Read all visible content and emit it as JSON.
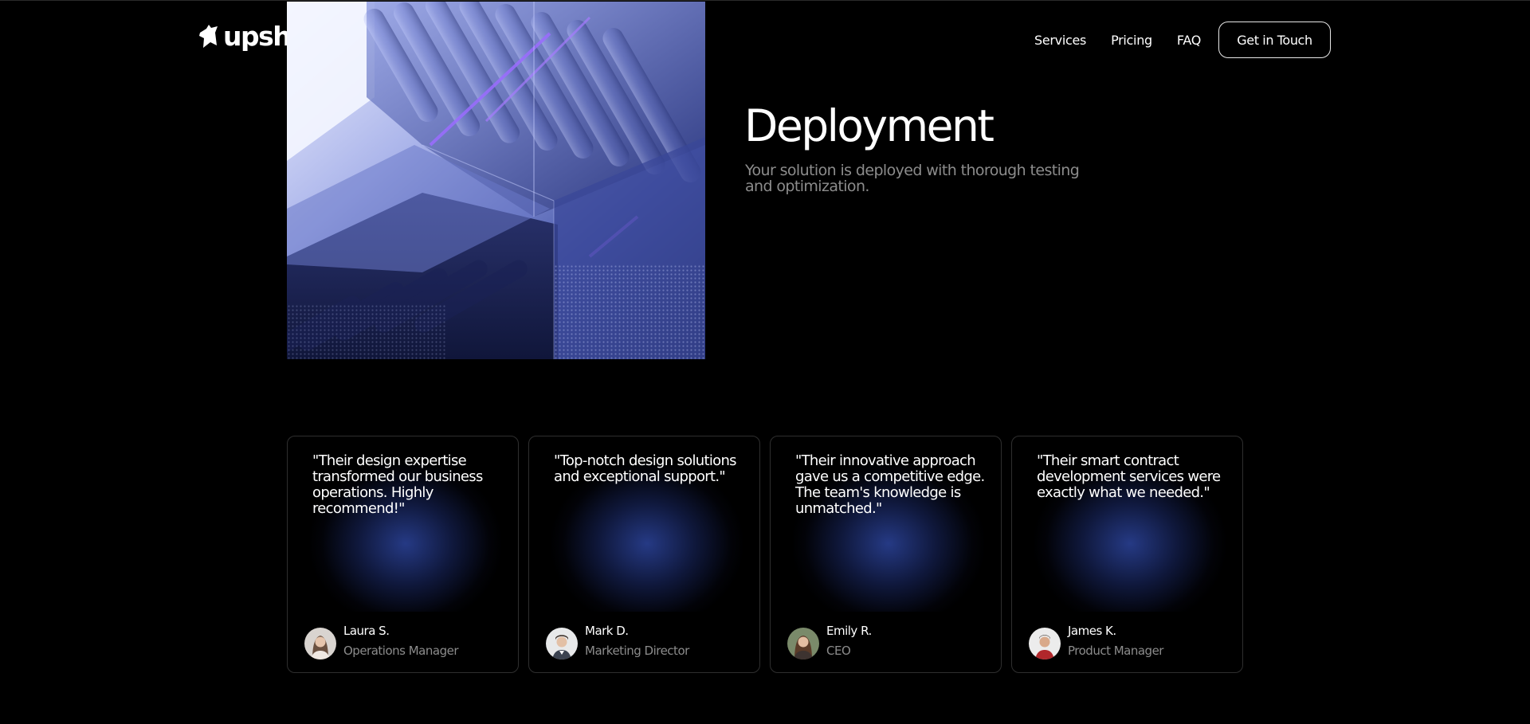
{
  "header": {
    "logo_text": "upshi",
    "logo_icon": "bird-logo-icon",
    "nav": [
      {
        "label": "Services"
      },
      {
        "label": "Pricing"
      },
      {
        "label": "FAQ"
      }
    ],
    "cta_label": "Get in Touch"
  },
  "step": {
    "title": "Deployment",
    "description": "Your solution is deployed with thorough testing and optimization."
  },
  "testimonials": [
    {
      "quote": "\"Their design expertise transformed our business operations. Highly recommend!\"",
      "name": "Laura S.",
      "role": "Operations Manager"
    },
    {
      "quote": "\"Top-notch design solutions and exceptional support.\"",
      "name": "Mark D.",
      "role": "Marketing Director"
    },
    {
      "quote": "\"Their innovative approach gave us a competitive edge. The team's knowledge is unmatched.\"",
      "name": "Emily R.",
      "role": "CEO"
    },
    {
      "quote": "\"Their smart contract development services were exactly what we needed.\"",
      "name": "James K.",
      "role": "Product Manager"
    }
  ],
  "colors": {
    "background": "#000000",
    "accent_glow": "#2c449c",
    "muted_text": "#8c8c8c",
    "card_border": "#2f2f2f"
  }
}
